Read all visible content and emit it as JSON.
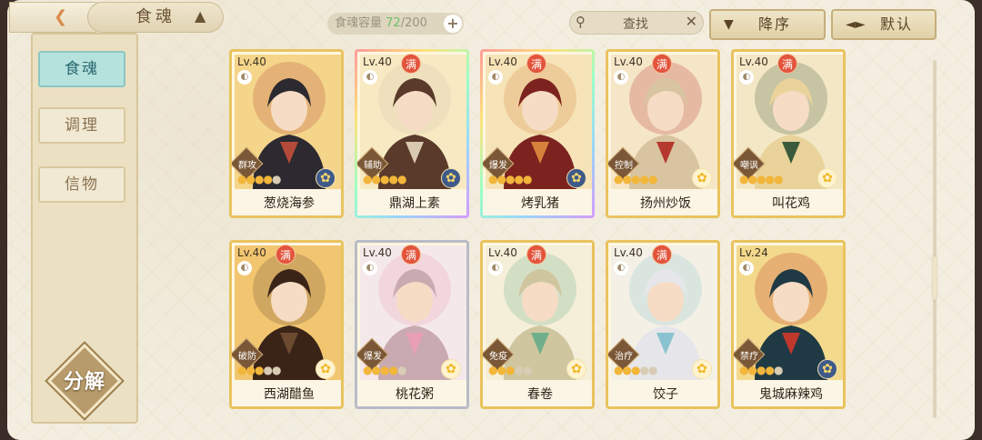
{
  "header": {
    "tab_title": "食魂",
    "capacity_label": "食魂容量",
    "capacity_current": "72",
    "capacity_max": "/200",
    "capacity_add": "+",
    "search_label": "查找",
    "sort_order_label": "降序",
    "sort_mode_label": "默认"
  },
  "sidebar": {
    "items": [
      {
        "label": "食魂",
        "active": true
      },
      {
        "label": "调理",
        "active": false
      },
      {
        "label": "信物",
        "active": false
      }
    ],
    "decompose_label": "分解"
  },
  "cards": [
    {
      "level": "Lv.40",
      "full": false,
      "full_label": "",
      "role": "群攻",
      "stars": 4,
      "name": "葱烧海参",
      "frame": "gold",
      "emblem": "blue",
      "palette": [
        "#f4d58a",
        "#2c2a30",
        "#b44a3a"
      ]
    },
    {
      "level": "Lv.40",
      "full": true,
      "full_label": "满",
      "role": "辅助",
      "stars": 5,
      "name": "鼎湖上素",
      "frame": "rainbow",
      "emblem": "blue",
      "palette": [
        "#f7e9c2",
        "#5a3a2a",
        "#d9c9b0"
      ]
    },
    {
      "level": "Lv.40",
      "full": true,
      "full_label": "满",
      "role": "爆发",
      "stars": 5,
      "name": "烤乳猪",
      "frame": "rainbow",
      "emblem": "blue",
      "palette": [
        "#f6e4b8",
        "#7c2320",
        "#d7823a"
      ]
    },
    {
      "level": "Lv.40",
      "full": true,
      "full_label": "满",
      "role": "控制",
      "stars": 5,
      "name": "扬州炒饭",
      "frame": "gold",
      "emblem": "yellow",
      "palette": [
        "#f6e6c8",
        "#d8c4a0",
        "#b6392e"
      ]
    },
    {
      "level": "Lv.40",
      "full": true,
      "full_label": "满",
      "role": "嘲讽",
      "stars": 5,
      "name": "叫花鸡",
      "frame": "gold",
      "emblem": "yellow",
      "palette": [
        "#f4e7c6",
        "#e9d39a",
        "#3a5a3c"
      ]
    },
    {
      "level": "Lv.40",
      "full": true,
      "full_label": "满",
      "role": "破防",
      "stars": 3,
      "name": "西湖醋鱼",
      "frame": "gold",
      "emblem": "yellow",
      "palette": [
        "#f2c670",
        "#3a2418",
        "#6b4a30"
      ]
    },
    {
      "level": "Lv.40",
      "full": true,
      "full_label": "满",
      "role": "爆发",
      "stars": 4,
      "name": "桃花粥",
      "frame": "silver",
      "emblem": "yellow",
      "palette": [
        "#f5e8ea",
        "#c9aab0",
        "#e9a0b4"
      ]
    },
    {
      "level": "Lv.40",
      "full": true,
      "full_label": "满",
      "role": "免疫",
      "stars": 3,
      "name": "春卷",
      "frame": "gold",
      "emblem": "yellow",
      "palette": [
        "#f5efd9",
        "#cfc6a0",
        "#6fb08a"
      ]
    },
    {
      "level": "Lv.40",
      "full": true,
      "full_label": "满",
      "role": "治疗",
      "stars": 3,
      "name": "饺子",
      "frame": "gold",
      "emblem": "yellow",
      "palette": [
        "#f4f0e6",
        "#e6e6ea",
        "#8ac3cf"
      ]
    },
    {
      "level": "Lv.24",
      "full": false,
      "full_label": "",
      "role": "禁疗",
      "stars": 4,
      "name": "鬼城麻辣鸡",
      "frame": "gold",
      "emblem": "blue",
      "palette": [
        "#f3d98c",
        "#1f3a44",
        "#c0382c"
      ]
    }
  ],
  "colors": {
    "accent": "#e9c35e",
    "active_tab": "#b6e2de",
    "capacity_number": "#6ec06a",
    "full_badge": "#e2543c"
  }
}
